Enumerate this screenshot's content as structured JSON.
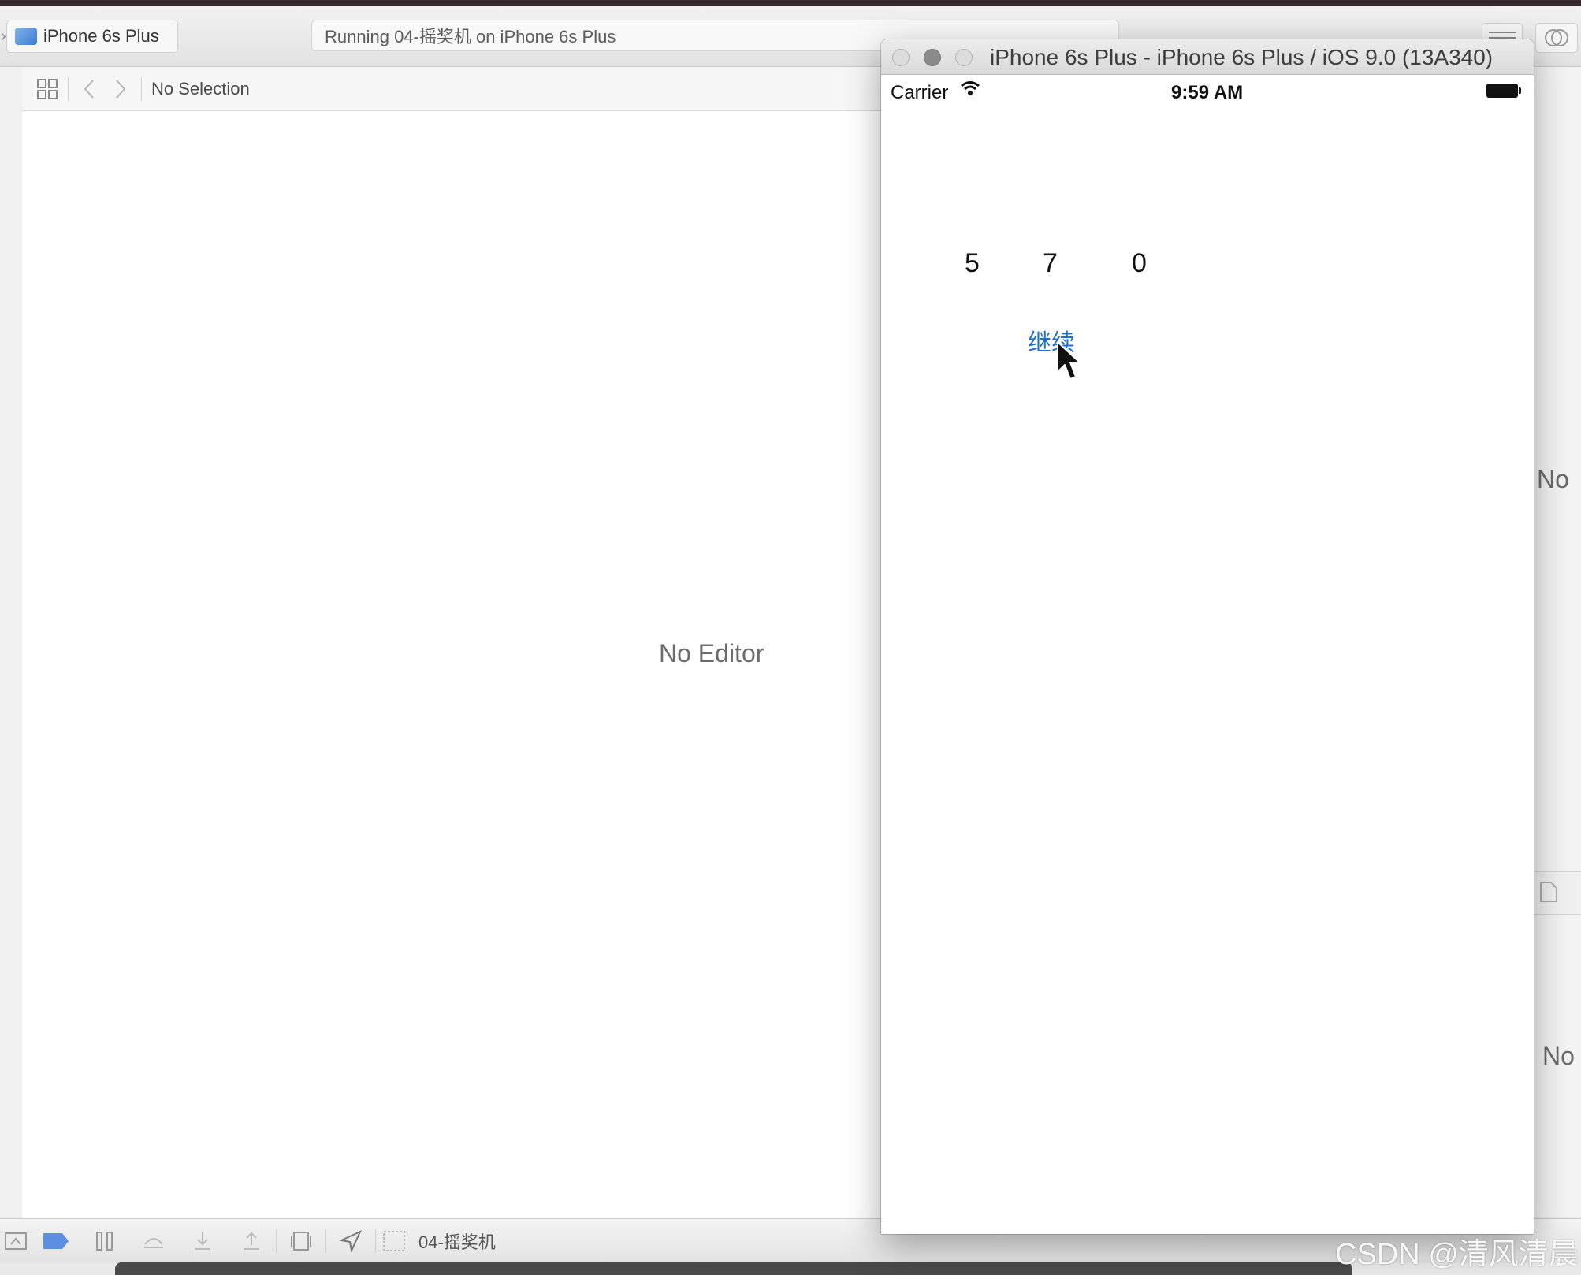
{
  "toolbar": {
    "scheme_destination": "iPhone 6s Plus",
    "activity_status": "Running 04-摇奖机 on iPhone 6s Plus"
  },
  "jumpbar": {
    "selection_label": "No Selection"
  },
  "editor": {
    "placeholder": "No Editor"
  },
  "utilities": {
    "placeholder_top": "No",
    "placeholder_bottom": "No"
  },
  "debug_bar": {
    "process_label": "04-摇奖机"
  },
  "simulator": {
    "window_title": "iPhone 6s Plus - iPhone 6s Plus / iOS 9.0 (13A340)",
    "status_bar": {
      "carrier": "Carrier",
      "time": "9:59 AM"
    },
    "app": {
      "numbers": [
        "5",
        "7",
        "0"
      ],
      "continue_button": "继续"
    }
  },
  "watermark": "CSDN @清风清晨",
  "colors": {
    "button_tint": "#1a6fd6",
    "scheme_icon": "#3c7dd0"
  },
  "icons": [
    "grid-icon",
    "back-arrow-icon",
    "forward-arrow-icon",
    "wifi-icon",
    "battery-icon",
    "breakpoint-icon",
    "pause-icon",
    "step-over-icon",
    "step-in-icon",
    "step-out-icon",
    "view-debugger-icon",
    "location-icon",
    "mouse-cursor-icon"
  ]
}
